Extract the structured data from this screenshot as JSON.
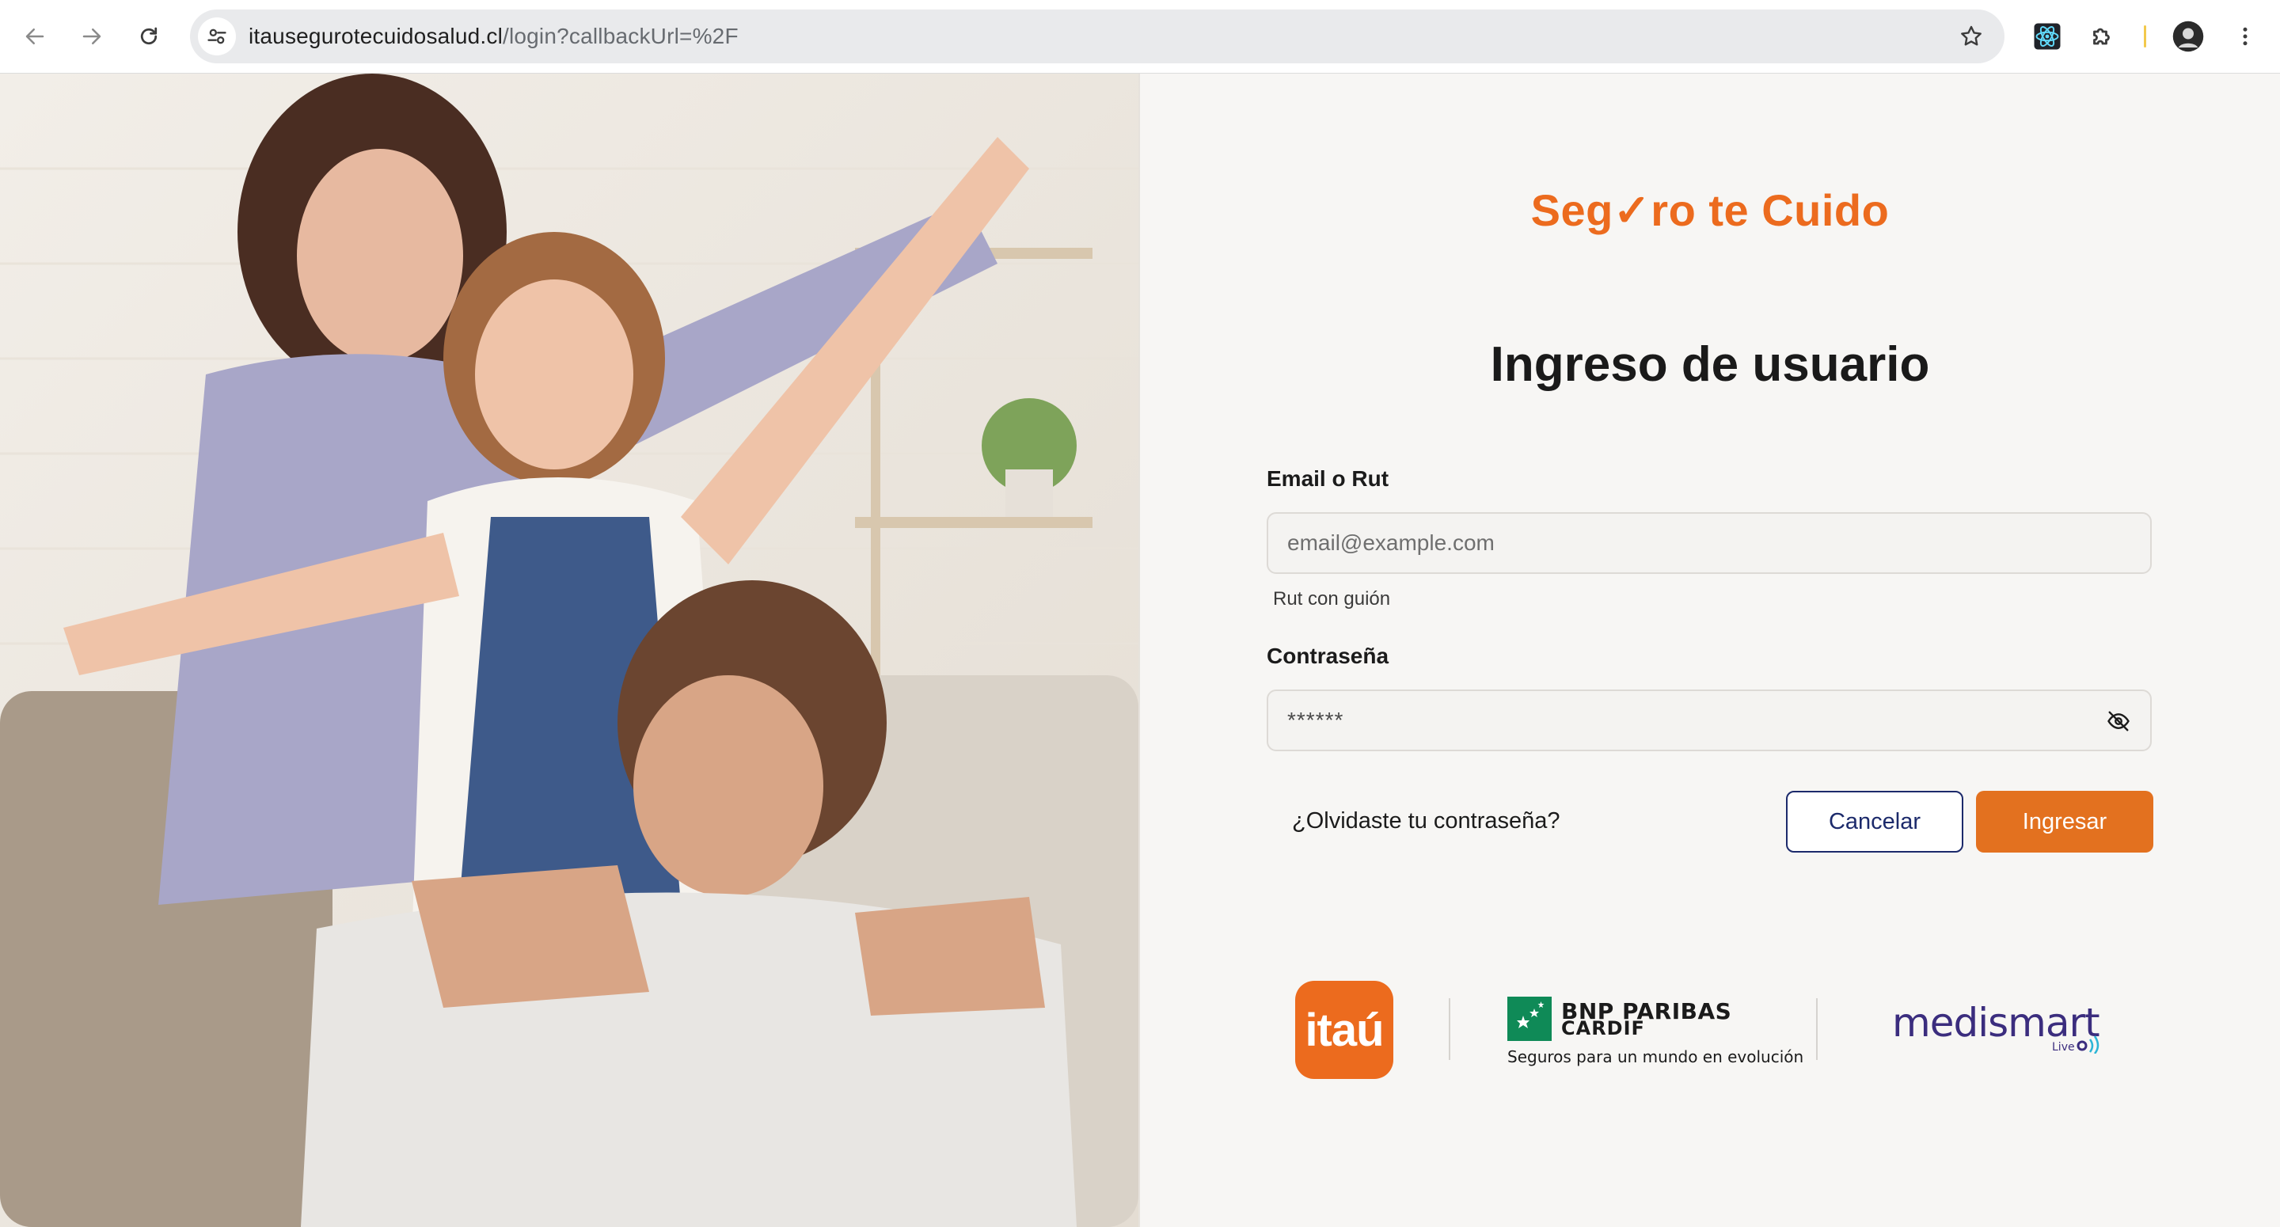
{
  "browser": {
    "url_host": "itausegurotecuidosalud.cl",
    "url_path": "/login?callbackUrl=%2F",
    "icons": {
      "back": "back-arrow-icon",
      "forward": "forward-arrow-icon",
      "reload": "reload-icon",
      "site_info": "site-info-icon",
      "bookmark": "star-icon",
      "react_ext": "react-devtools-icon",
      "extensions": "puzzle-icon",
      "profile": "avatar",
      "menu": "kebab-menu-icon"
    }
  },
  "brand": {
    "logo_text": "Seg✓ro te Cuido",
    "color": "#ec6b1e"
  },
  "login": {
    "title": "Ingreso de usuario",
    "email_label": "Email o Rut",
    "email_placeholder": "email@example.com",
    "email_hint": "Rut con guión",
    "password_label": "Contraseña",
    "password_value": "******",
    "forgot_link": "¿Olvidaste tu contraseña?",
    "cancel_button": "Cancelar",
    "submit_button": "Ingresar"
  },
  "partners": {
    "itau": "itaú",
    "bnp_name": "BNP PARIBAS",
    "bnp_sub": "CARDIF",
    "bnp_tagline": "Seguros para un mundo en evolución",
    "medismart": "medismart",
    "medismart_sub": "Live"
  },
  "colors": {
    "accent_orange": "#e3711f",
    "navy": "#1c2a6b",
    "bnp_green": "#0f8a57",
    "medismart_purple": "#3b2d7e"
  }
}
